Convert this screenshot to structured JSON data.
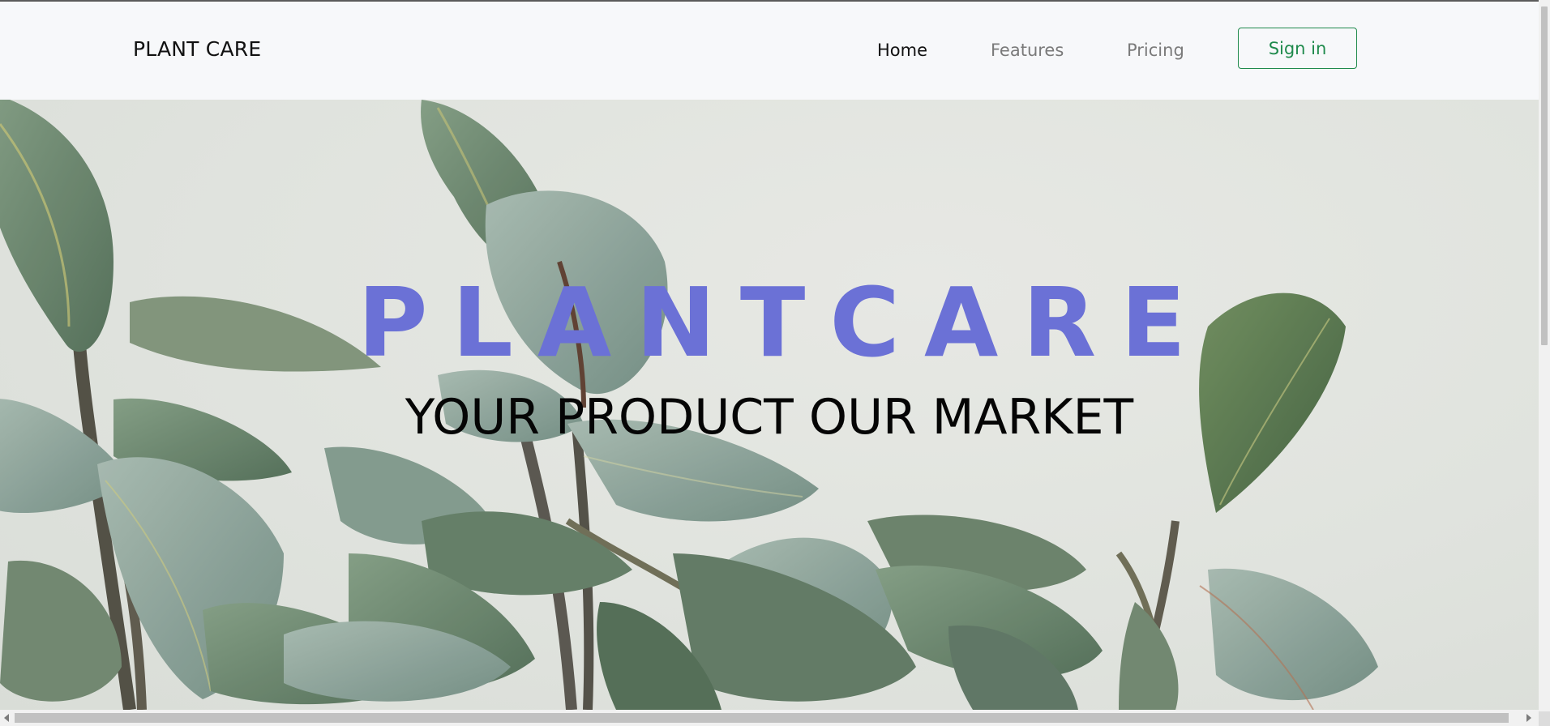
{
  "navbar": {
    "brand": "PLANT CARE",
    "links": [
      {
        "label": "Home",
        "active": true
      },
      {
        "label": "Features",
        "active": false
      },
      {
        "label": "Pricing",
        "active": false
      }
    ],
    "signin_label": "Sign in",
    "accent_color": "#1f8a4c"
  },
  "hero": {
    "title": "PLANTCARE",
    "subtitle": "YOUR PRODUCT OUR MARKET",
    "title_color": "#6b71d6",
    "background_image": "plant-leaves-image"
  }
}
